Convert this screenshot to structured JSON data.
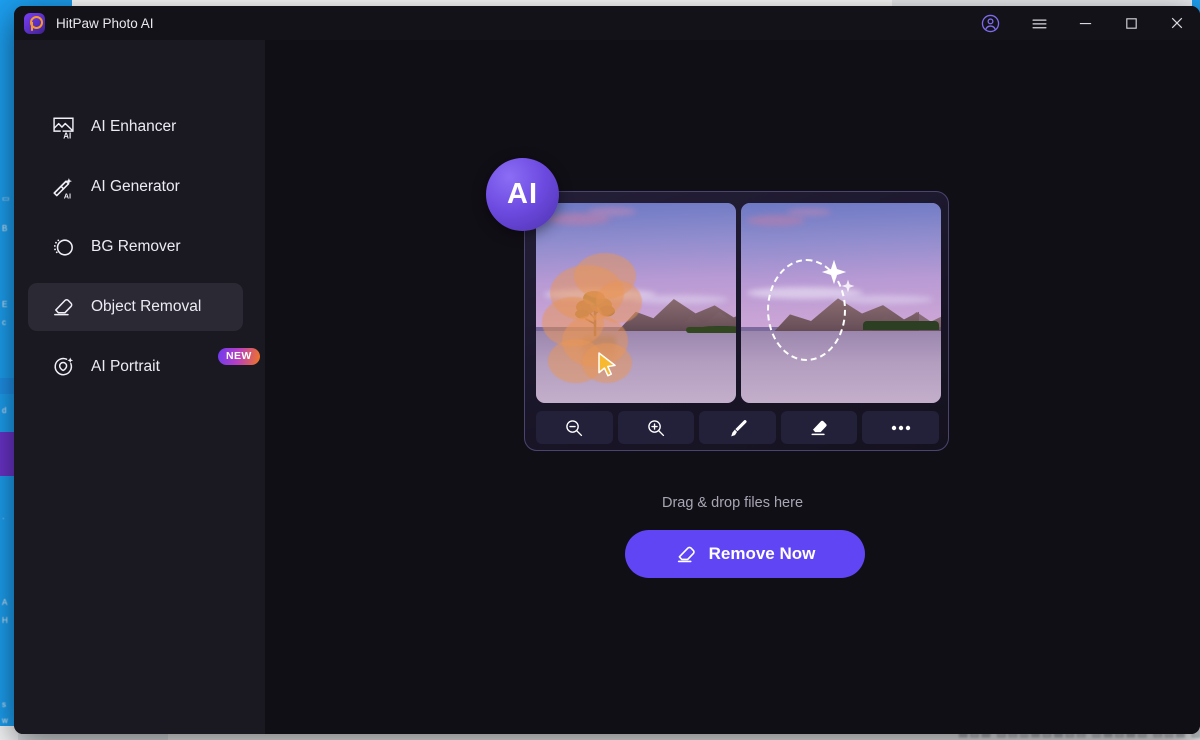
{
  "window": {
    "title": "HitPaw Photo AI",
    "logo_icon": "hitpaw-logo-icon",
    "controls": {
      "account": "account-icon",
      "menu": "hamburger-menu-icon",
      "minimize": "minimize-icon",
      "maximize": "maximize-icon",
      "close": "close-icon"
    }
  },
  "sidebar": {
    "items": [
      {
        "label": "AI Enhancer",
        "icon": "image-ai-icon",
        "active": false,
        "badge": ""
      },
      {
        "label": "AI Generator",
        "icon": "magic-wand-ai-icon",
        "active": false,
        "badge": ""
      },
      {
        "label": "BG Remover",
        "icon": "bg-remove-icon",
        "active": false,
        "badge": ""
      },
      {
        "label": "Object Removal",
        "icon": "eraser-icon",
        "active": true,
        "badge": ""
      },
      {
        "label": "AI Portrait",
        "icon": "portrait-sparkle-icon",
        "active": false,
        "badge": "NEW"
      }
    ]
  },
  "main": {
    "hero": {
      "badge_text": "AI",
      "before_pane_label": "before-photo",
      "after_pane_label": "after-photo",
      "toolbar": [
        {
          "label": "Zoom Out",
          "icon": "zoom-out-icon"
        },
        {
          "label": "Zoom In",
          "icon": "zoom-in-icon"
        },
        {
          "label": "Brush",
          "icon": "brush-icon"
        },
        {
          "label": "Eraser",
          "icon": "eraser-icon"
        },
        {
          "label": "More",
          "icon": "more-options-icon"
        }
      ]
    },
    "drop_text": "Drag & drop files here",
    "cta": {
      "label": "Remove Now",
      "icon": "eraser-icon"
    }
  },
  "colors": {
    "accent": "#6045f5",
    "app_bg": "#110f16",
    "sidebar_bg": "#1a1820",
    "sidebar_active": "#2b2933",
    "titlebar_bg": "#141219",
    "badge_gradient_start": "#6d3bf0",
    "badge_gradient_end": "#f1761f",
    "desktop_bg": "#1c9ff0"
  }
}
